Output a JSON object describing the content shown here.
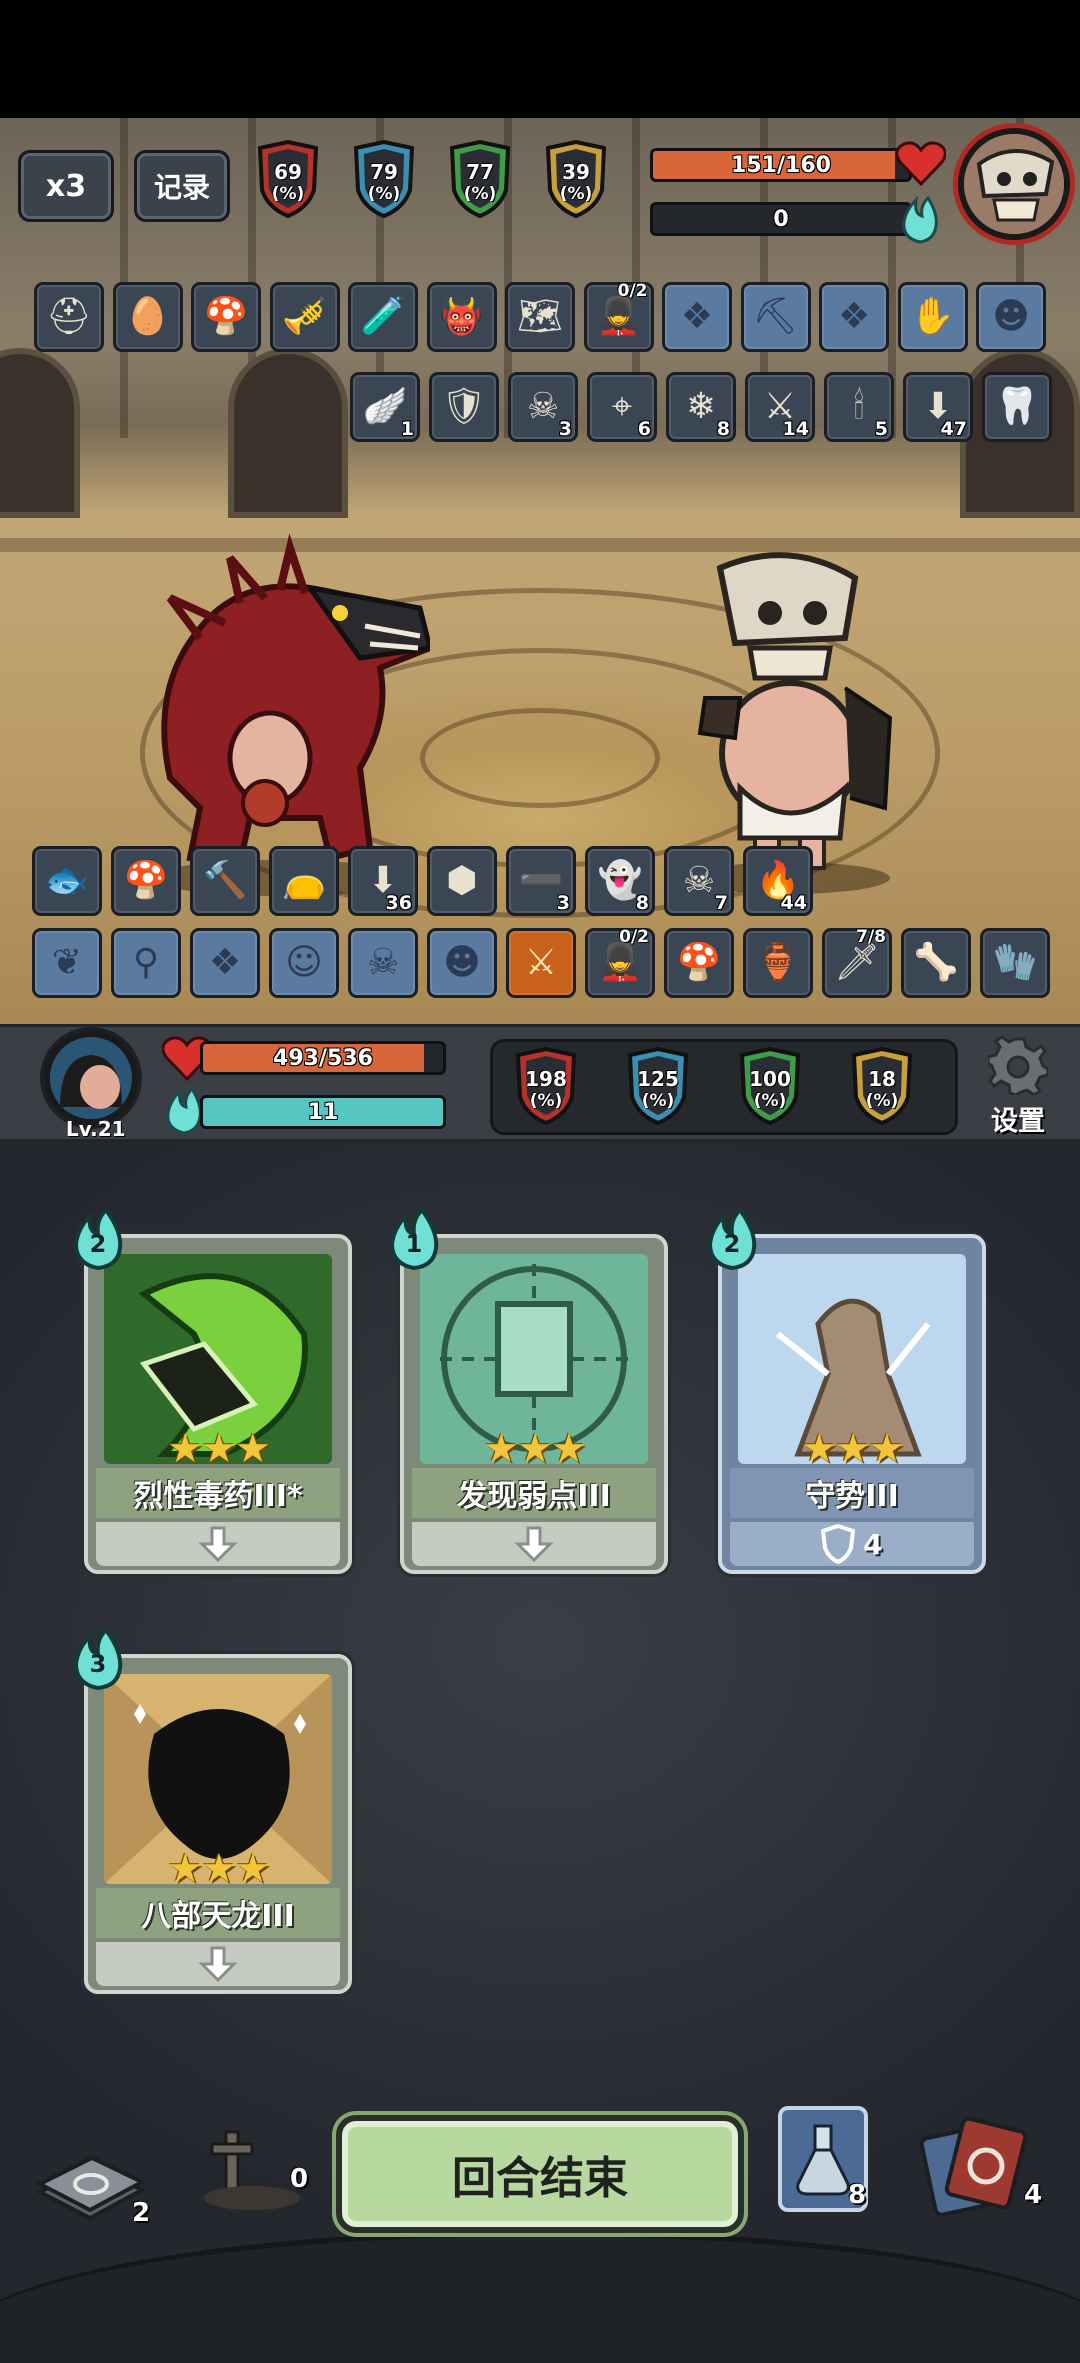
{
  "enemy": {
    "speed_button": "x3",
    "log_button": "记录",
    "stats": [
      {
        "value": "69",
        "unit": "(%)",
        "color": "#b3322b",
        "icon": "attack-down-icon"
      },
      {
        "value": "79",
        "unit": "(%)",
        "color": "#3b8fb0",
        "icon": "question-icon"
      },
      {
        "value": "77",
        "unit": "(%)",
        "color": "#3f9c4a",
        "icon": "defense-icon"
      },
      {
        "value": "39",
        "unit": "(%)",
        "color": "#c6a13a",
        "icon": "attack-up-icon"
      }
    ],
    "hp": {
      "text": "151/160",
      "current": 151,
      "max": 160
    },
    "energy": {
      "text": "0",
      "current": 0
    },
    "relics": [
      {
        "icon": "helmet-icon",
        "glyph": "⛑"
      },
      {
        "icon": "egg-icon",
        "glyph": "🥚"
      },
      {
        "icon": "mushroom-icon",
        "glyph": "🍄"
      },
      {
        "icon": "flute-icon",
        "glyph": "🎺"
      },
      {
        "icon": "bottle-icon",
        "glyph": "🧪"
      },
      {
        "icon": "demon-icon",
        "glyph": "👹"
      },
      {
        "icon": "map-icon",
        "glyph": "🗺"
      },
      {
        "icon": "soldier-icon",
        "glyph": "💂",
        "badge": "0/2"
      },
      {
        "icon": "locked-relic-icon",
        "glyph": "❖",
        "locked": true
      },
      {
        "icon": "locked-relic-icon",
        "glyph": "⛏",
        "locked": true
      },
      {
        "icon": "locked-relic-icon",
        "glyph": "❖",
        "locked": true
      },
      {
        "icon": "locked-relic-icon",
        "glyph": "✋",
        "locked": true
      },
      {
        "icon": "locked-relic-icon",
        "glyph": "☻",
        "locked": true
      }
    ],
    "statuses": [
      {
        "icon": "wing-icon",
        "glyph": "🪽",
        "count": "1"
      },
      {
        "icon": "broken-shield-icon",
        "glyph": "🛡",
        "count": ""
      },
      {
        "icon": "poison-skull-icon",
        "glyph": "☠",
        "count": "3"
      },
      {
        "icon": "target-icon",
        "glyph": "⌖",
        "count": "6"
      },
      {
        "icon": "snowflake-icon",
        "glyph": "❄",
        "count": "8"
      },
      {
        "icon": "claw-icon",
        "glyph": "⚔",
        "count": "14"
      },
      {
        "icon": "candle-icon",
        "glyph": "🕯",
        "count": "5"
      },
      {
        "icon": "weaken-icon",
        "glyph": "⬇",
        "count": "47"
      },
      {
        "icon": "fang-icon",
        "glyph": "🦷",
        "count": ""
      }
    ]
  },
  "player": {
    "level": "Lv.21",
    "hp": {
      "text": "493/536",
      "current": 493,
      "max": 536
    },
    "energy": {
      "text": "11",
      "current": 11
    },
    "settings_label": "设置",
    "stats": [
      {
        "value": "198",
        "unit": "(%)",
        "color": "#b3322b",
        "icon": "attack-down-icon"
      },
      {
        "value": "125",
        "unit": "(%)",
        "color": "#3b8fb0",
        "icon": "question-icon"
      },
      {
        "value": "100",
        "unit": "(%)",
        "color": "#3f9c4a",
        "icon": "defense-icon"
      },
      {
        "value": "18",
        "unit": "(%)",
        "color": "#c6a13a",
        "icon": "attack-up-icon"
      }
    ],
    "statuses": [
      {
        "icon": "fish-icon",
        "glyph": "🐟",
        "count": ""
      },
      {
        "icon": "mushroom-icon",
        "glyph": "🍄",
        "count": ""
      },
      {
        "icon": "hammer-icon",
        "glyph": "🔨",
        "count": ""
      },
      {
        "icon": "pouch-icon",
        "glyph": "👝",
        "count": ""
      },
      {
        "icon": "weaken-icon",
        "glyph": "⬇",
        "count": "36"
      },
      {
        "icon": "green-shield-icon",
        "glyph": "⬢",
        "count": ""
      },
      {
        "icon": "slash-icon",
        "glyph": "➖",
        "count": "3"
      },
      {
        "icon": "ghost-icon",
        "glyph": "👻",
        "count": "8"
      },
      {
        "icon": "poison-skull-icon",
        "glyph": "☠",
        "count": "7"
      },
      {
        "icon": "fire-figure-icon",
        "glyph": "🔥",
        "count": "44"
      }
    ],
    "relics": [
      {
        "icon": "locked-relic-icon",
        "glyph": "❦",
        "locked": true
      },
      {
        "icon": "locked-relic-icon",
        "glyph": "⚲",
        "locked": true
      },
      {
        "icon": "locked-relic-icon",
        "glyph": "❖",
        "locked": true
      },
      {
        "icon": "locked-relic-icon",
        "glyph": "☺",
        "locked": true
      },
      {
        "icon": "locked-relic-icon",
        "glyph": "☠",
        "locked": true
      },
      {
        "icon": "locked-relic-icon",
        "glyph": "☻",
        "locked": true
      },
      {
        "icon": "sword-icon",
        "glyph": "⚔",
        "orange": true
      },
      {
        "icon": "soldier-icon",
        "glyph": "💂",
        "badge": "0/2"
      },
      {
        "icon": "mushroom-warrior-icon",
        "glyph": "🍄"
      },
      {
        "icon": "fire-pot-icon",
        "glyph": "🏺"
      },
      {
        "icon": "dagger-icon",
        "glyph": "🗡",
        "badge": "7/8"
      },
      {
        "icon": "bone-icon",
        "glyph": "🦴"
      },
      {
        "icon": "gauntlet-icon",
        "glyph": "🧤"
      }
    ]
  },
  "hand": [
    {
      "name": "烈性毒药III*",
      "cost": "2",
      "stars": "★★★",
      "style": "green",
      "icon": "poison-card-icon",
      "footer": "arrow"
    },
    {
      "name": "发现弱点III",
      "cost": "1",
      "stars": "★★★",
      "style": "green",
      "icon": "weakness-card-icon",
      "footer": "arrow"
    },
    {
      "name": "守势III",
      "cost": "2",
      "stars": "★★★",
      "style": "blue",
      "icon": "defense-card-icon",
      "footer": "shield",
      "shield_value": "4"
    },
    {
      "name": "八部天龙III",
      "cost": "3",
      "stars": "★★★",
      "style": "green",
      "icon": "dragon-card-icon",
      "footer": "arrow"
    }
  ],
  "bottom": {
    "draw_pile": "2",
    "grave_pile": "0",
    "end_turn": "回合结束",
    "potion_count": "8",
    "discard_pile": "4"
  }
}
